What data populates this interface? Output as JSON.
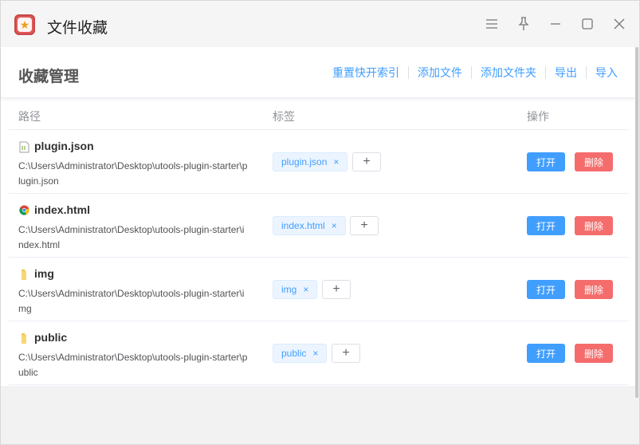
{
  "window": {
    "title": "文件收藏",
    "controls": [
      "menu-icon",
      "pin-icon",
      "minimize-icon",
      "maximize-icon",
      "close-icon"
    ]
  },
  "header": {
    "title": "收藏管理",
    "actions": [
      "重置快开索引",
      "添加文件",
      "添加文件夹",
      "导出",
      "导入"
    ]
  },
  "table": {
    "columns": [
      "路径",
      "标签",
      "操作"
    ],
    "rows": [
      {
        "icon": "json-file-icon",
        "name": "plugin.json",
        "path": "C:\\Users\\Administrator\\Desktop\\utools-plugin-starter\\plugin.json",
        "tag": "plugin.json",
        "tag_close": "×",
        "add": "+",
        "open": "打开",
        "delete": "删除"
      },
      {
        "icon": "chrome-html-icon",
        "name": "index.html",
        "path": "C:\\Users\\Administrator\\Desktop\\utools-plugin-starter\\index.html",
        "tag": "index.html",
        "tag_close": "×",
        "add": "+",
        "open": "打开",
        "delete": "删除"
      },
      {
        "icon": "folder-icon",
        "name": "img",
        "path": "C:\\Users\\Administrator\\Desktop\\utools-plugin-starter\\img",
        "tag": "img",
        "tag_close": "×",
        "add": "+",
        "open": "打开",
        "delete": "删除"
      },
      {
        "icon": "folder-icon",
        "name": "public",
        "path": "C:\\Users\\Administrator\\Desktop\\utools-plugin-starter\\public",
        "tag": "public",
        "tag_close": "×",
        "add": "+",
        "open": "打开",
        "delete": "删除"
      }
    ]
  },
  "colors": {
    "primary": "#409eff",
    "danger": "#f56c6c",
    "tag_bg": "#ecf5ff"
  }
}
